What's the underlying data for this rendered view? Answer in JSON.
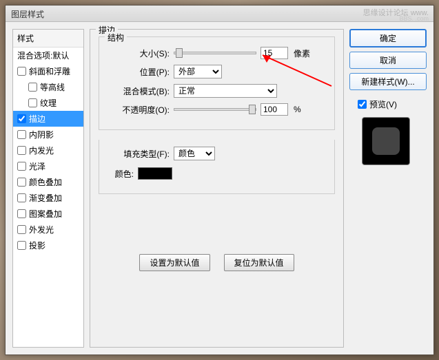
{
  "titlebar": "图层样式",
  "watermark": "思缘设计论坛  www.",
  "watermark2": "BBS.  .com",
  "styles": {
    "header": "样式",
    "blend": "混合选项:默认",
    "items": [
      {
        "label": "斜面和浮雕",
        "checked": false
      },
      {
        "label": "等高线",
        "checked": false
      },
      {
        "label": "纹理",
        "checked": false
      },
      {
        "label": "描边",
        "checked": true,
        "selected": true
      },
      {
        "label": "内阴影",
        "checked": false
      },
      {
        "label": "内发光",
        "checked": false
      },
      {
        "label": "光泽",
        "checked": false
      },
      {
        "label": "颜色叠加",
        "checked": false
      },
      {
        "label": "渐变叠加",
        "checked": false
      },
      {
        "label": "图案叠加",
        "checked": false
      },
      {
        "label": "外发光",
        "checked": false
      },
      {
        "label": "投影",
        "checked": false
      }
    ]
  },
  "center": {
    "title": "描边",
    "structure": "结构",
    "size_label": "大小(S):",
    "size_value": "15",
    "size_unit": "像素",
    "position_label": "位置(P):",
    "position_value": "外部",
    "blend_label": "混合模式(B):",
    "blend_value": "正常",
    "opacity_label": "不透明度(O):",
    "opacity_value": "100",
    "opacity_unit": "%",
    "fill_label": "填充类型(F):",
    "fill_value": "颜色",
    "color_label": "颜色:",
    "default_btn": "设置为默认值",
    "reset_btn": "复位为默认值"
  },
  "right": {
    "ok": "确定",
    "cancel": "取消",
    "new_style": "新建样式(W)...",
    "preview": "预览(V)"
  }
}
